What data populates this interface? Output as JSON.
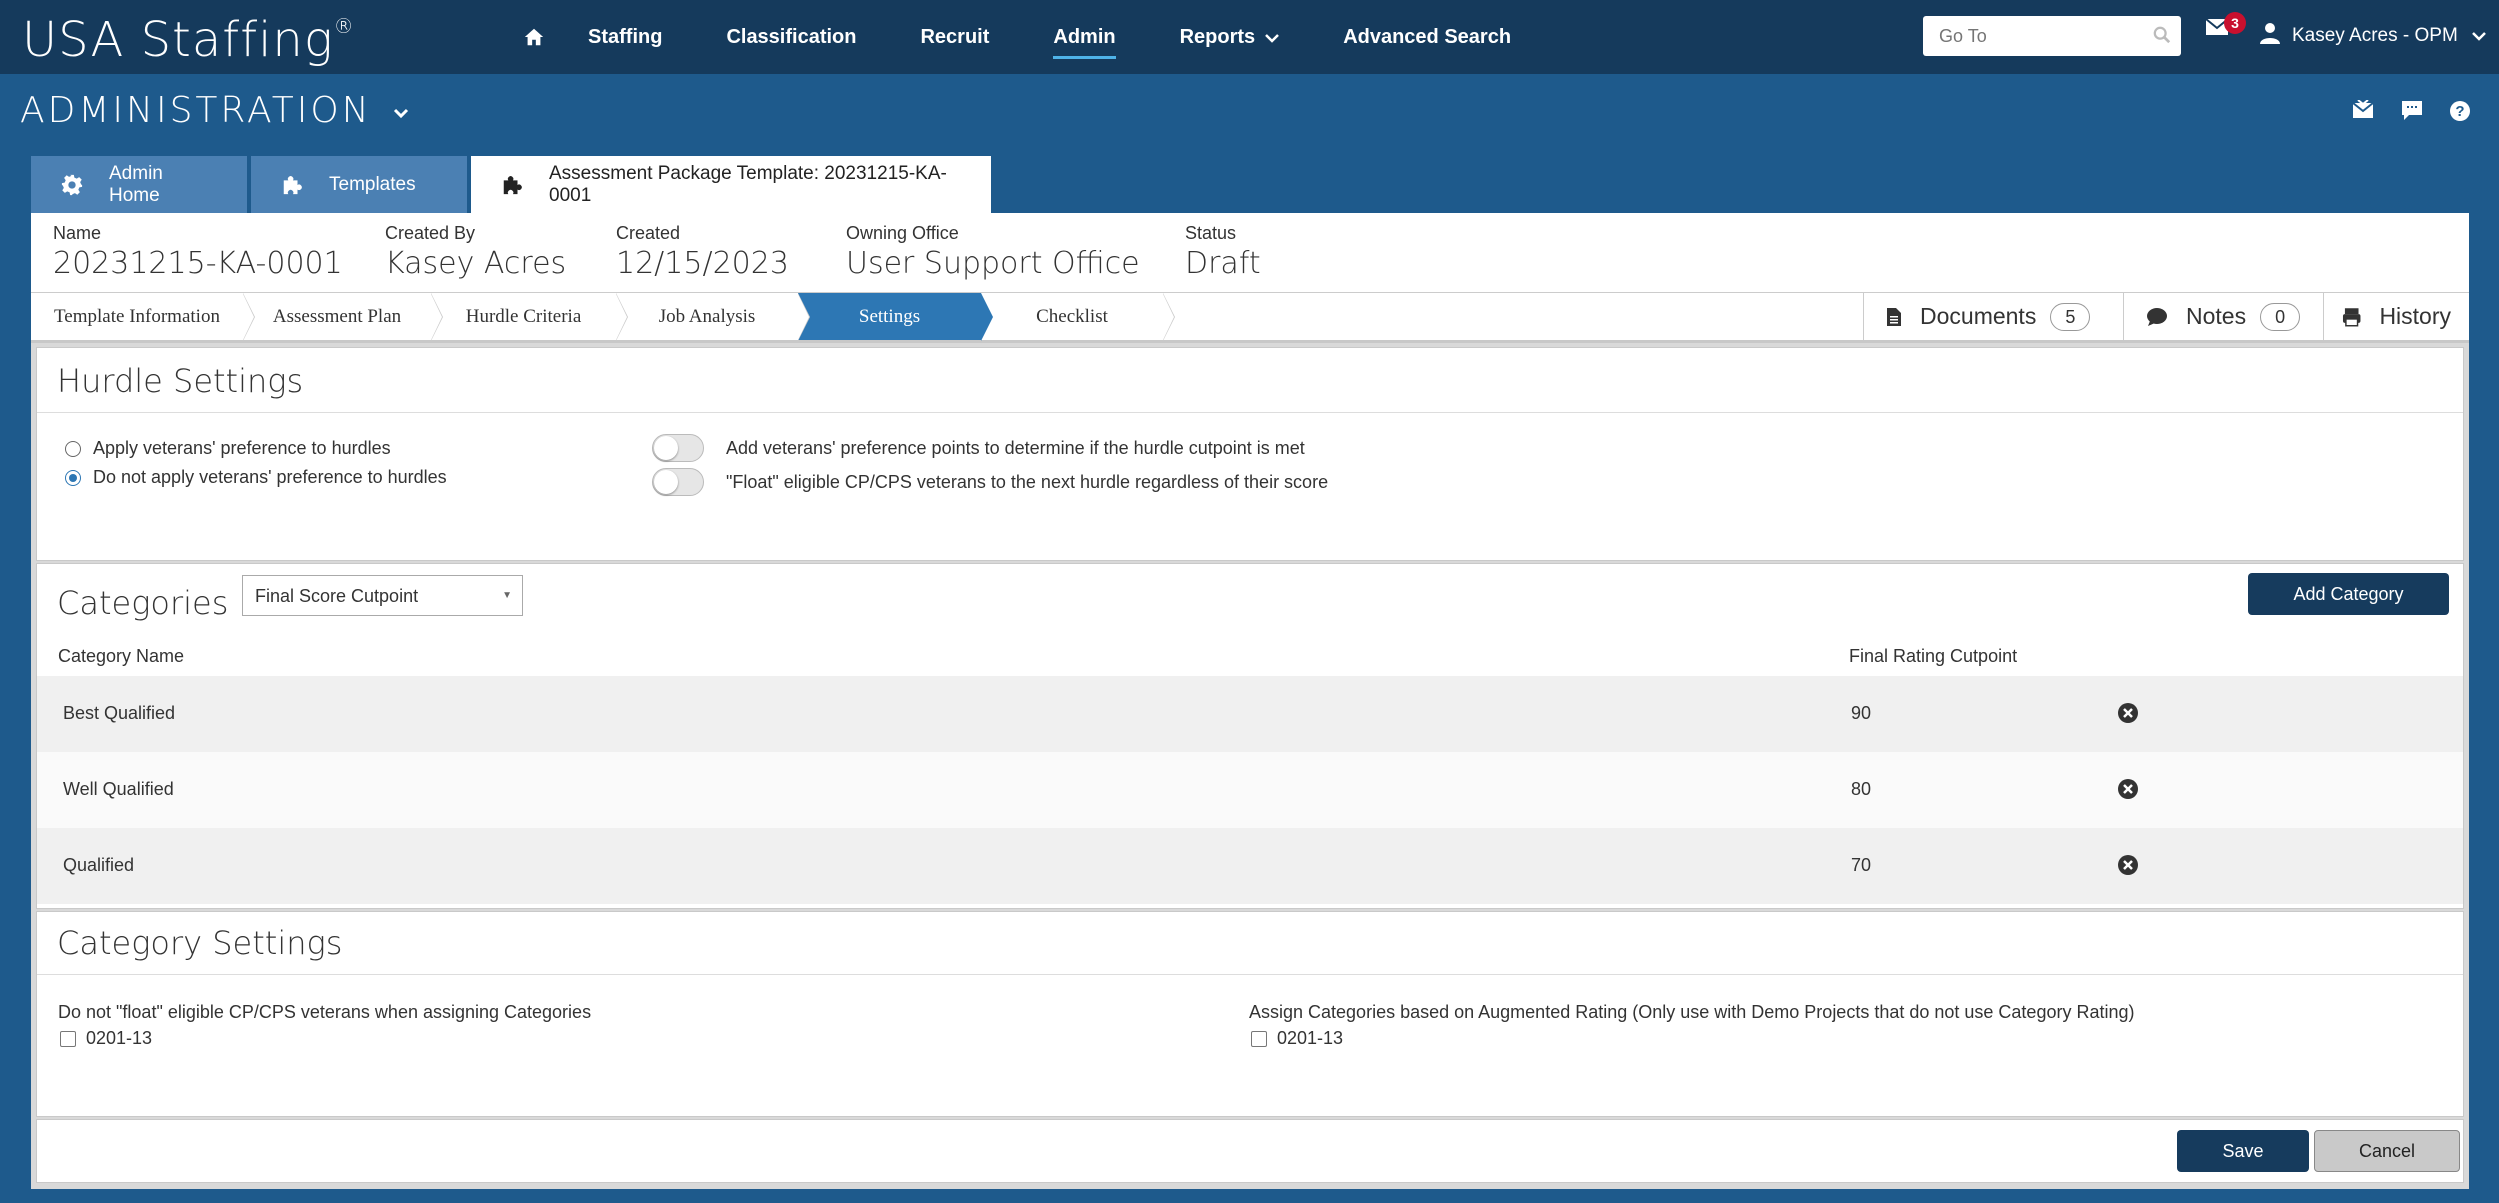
{
  "app": {
    "logo": "USA Staffing",
    "logo_mark": "®"
  },
  "nav": {
    "items": [
      "Staffing",
      "Classification",
      "Recruit",
      "Admin",
      "Reports",
      "Advanced Search"
    ],
    "active": "Admin",
    "goto_placeholder": "Go To",
    "mail_count": "3",
    "user_name": "Kasey Acres - OPM"
  },
  "page": {
    "title": "ADMINISTRATION"
  },
  "tabs": [
    {
      "label": "Admin Home",
      "icon": "gear-icon"
    },
    {
      "label": "Templates",
      "icon": "puzzle-icon"
    },
    {
      "label": "Assessment Package Template: 20231215-KA-0001",
      "icon": "puzzle-icon",
      "active": true
    }
  ],
  "summary": {
    "name_label": "Name",
    "name": "20231215-KA-0001",
    "created_by_label": "Created By",
    "created_by": "Kasey Acres",
    "created_label": "Created",
    "created": "12/15/2023",
    "office_label": "Owning Office",
    "office": "User Support Office",
    "status_label": "Status",
    "status": "Draft"
  },
  "wizard": {
    "steps": [
      "Template Information",
      "Assessment Plan",
      "Hurdle Criteria",
      "Job Analysis",
      "Settings",
      "Checklist"
    ],
    "active": "Settings",
    "documents_label": "Documents",
    "documents_count": "5",
    "notes_label": "Notes",
    "notes_count": "0",
    "history_label": "History"
  },
  "hurdle": {
    "title": "Hurdle Settings",
    "radio_apply": "Apply veterans' preference to hurdles",
    "radio_no_apply": "Do not apply veterans' preference to hurdles",
    "selected": "radio_no_apply",
    "toggle_points": "Add veterans' preference points to determine if the hurdle cutpoint is met",
    "toggle_float": "\"Float\" eligible CP/CPS veterans to the next hurdle regardless of their score",
    "toggle_points_on": false,
    "toggle_float_on": false
  },
  "categories": {
    "title": "Categories",
    "select_value": "Final Score Cutpoint",
    "add_label": "Add Category",
    "col_name": "Category Name",
    "col_cutpoint": "Final Rating Cutpoint",
    "rows": [
      {
        "name": "Best Qualified",
        "cutpoint": "90"
      },
      {
        "name": "Well Qualified",
        "cutpoint": "80"
      },
      {
        "name": "Qualified",
        "cutpoint": "70"
      }
    ]
  },
  "category_settings": {
    "title": "Category Settings",
    "left_label": "Do not \"float\" eligible CP/CPS veterans when assigning Categories",
    "left_option": "0201-13",
    "right_label": "Assign Categories based on Augmented Rating (Only use with Demo Projects that do not use Category Rating)",
    "right_option": "0201-13"
  },
  "footer": {
    "save": "Save",
    "cancel": "Cancel"
  },
  "colors": {
    "nav_bg": "#153a5c",
    "page_bg": "#1e5a8c",
    "tab_bg": "#4b80b3",
    "active_step": "#2d77b4",
    "primary_btn": "#163b5d",
    "badge": "#c8102e"
  }
}
